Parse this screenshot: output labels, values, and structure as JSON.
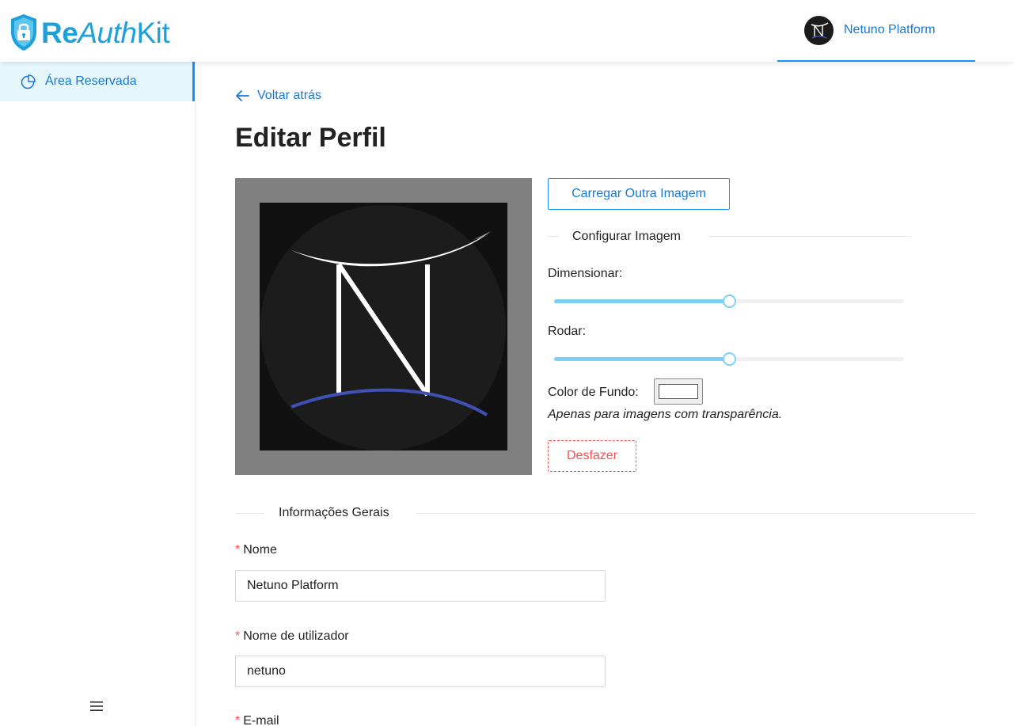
{
  "header": {
    "logo": {
      "part1": "Re",
      "part2": "Auth",
      "part3": "Kit",
      "color": "#1ea0dc",
      "icon": "shield-lock-icon"
    },
    "user": {
      "name": "Netuno Platform",
      "avatar_icon": "netuno-logo-icon"
    }
  },
  "sidebar": {
    "items": [
      {
        "label": "Área Reservada",
        "icon": "pie-chart-icon",
        "active": true
      }
    ],
    "toggle_icon": "menu-icon"
  },
  "main": {
    "back_label": "Voltar atrás",
    "title": "Editar Perfil",
    "upload_button": "Carregar Outra Imagem",
    "image_config_title": "Configurar Imagem",
    "resize_label": "Dimensionar:",
    "resize_value": 0.5,
    "rotate_label": "Rodar:",
    "rotate_value": 0.5,
    "bg_color_label": "Color de Fundo:",
    "bg_color_value": "#ffffff",
    "bg_color_note": "Apenas para imagens com transparência.",
    "undo_button": "Desfazer",
    "general_info_title": "Informações Gerais",
    "fields": {
      "name": {
        "label": "Nome",
        "value": "Netuno Platform",
        "required": true
      },
      "username": {
        "label": "Nome de utilizador",
        "value": "netuno",
        "required": true
      },
      "email": {
        "label": "E-mail",
        "required": true
      }
    }
  },
  "colors": {
    "primary": "#1890ff",
    "danger": "#ff4d4f",
    "slider": "#7fd0f6",
    "active_bg": "#e6f7fc"
  }
}
